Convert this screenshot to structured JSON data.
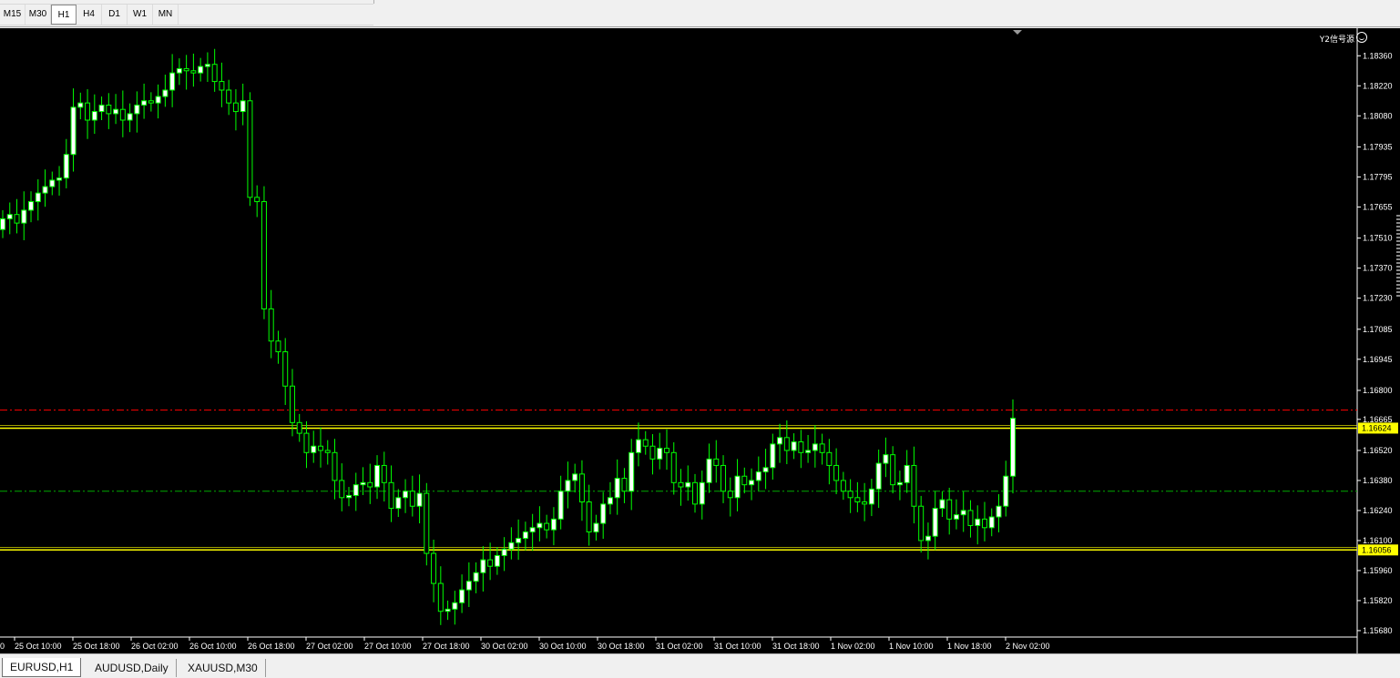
{
  "timeframes": [
    "M15",
    "M30",
    "H1",
    "H4",
    "D1",
    "W1",
    "MN"
  ],
  "active_timeframe": "H1",
  "corner_label": "Y2信号源",
  "tabs": [
    {
      "label": "EURUSD,H1",
      "active": true
    },
    {
      "label": "AUDUSD,Daily",
      "active": false
    },
    {
      "label": "XAUUSD,M30",
      "active": false
    }
  ],
  "colors": {
    "background": "#000000",
    "bull_fill": "#ffffff",
    "bull_outline": "#00ff00",
    "bear_fill": "#000000",
    "bear_outline": "#00ff00",
    "support_line": "#ffff00",
    "resistance_dash": "#ff0000",
    "mid_dash": "#00aa00",
    "axis_text": "#ffffff",
    "label_bg_yellow": "#ffff00"
  },
  "chart_data": {
    "type": "candlestick",
    "symbol": "EURUSD",
    "timeframe": "H1",
    "yticks": [
      "1.18360",
      "1.18220",
      "1.18080",
      "1.17935",
      "1.17795",
      "1.17655",
      "1.17510",
      "1.17370",
      "1.17230",
      "1.17085",
      "1.16945",
      "1.16800",
      "1.16665",
      "1.16520",
      "1.16380",
      "1.16240",
      "1.16100",
      "1.15960",
      "1.15820",
      "1.15680"
    ],
    "xticks": [
      "25 Oct 10:00",
      "25 Oct 18:00",
      "26 Oct 02:00",
      "26 Oct 10:00",
      "26 Oct 18:00",
      "27 Oct 02:00",
      "27 Oct 10:00",
      "27 Oct 18:00",
      "30 Oct 02:00",
      "30 Oct 10:00",
      "30 Oct 18:00",
      "31 Oct 02:00",
      "31 Oct 10:00",
      "31 Oct 18:00",
      "1 Nov 02:00",
      "1 Nov 10:00",
      "1 Nov 18:00",
      "2 Nov 02:00"
    ],
    "ylim": [
      1.1565,
      1.1848
    ],
    "horizontal_lines": [
      {
        "price": 1.16624,
        "style": "solid",
        "color": "support_line",
        "label": "1.16624"
      },
      {
        "price": 1.16056,
        "style": "solid",
        "color": "support_line",
        "label": "1.16056"
      },
      {
        "price": 1.16708,
        "style": "dashdot",
        "color": "resistance_dash"
      },
      {
        "price": 1.1633,
        "style": "dashdot",
        "color": "mid_dash"
      }
    ],
    "closes": [
      1.176,
      1.1762,
      1.1758,
      1.1764,
      1.1768,
      1.1772,
      1.1775,
      1.1778,
      1.1779,
      1.179,
      1.1812,
      1.1814,
      1.1806,
      1.181,
      1.1813,
      1.1809,
      1.1811,
      1.1806,
      1.1809,
      1.1813,
      1.1815,
      1.1814,
      1.1817,
      1.182,
      1.1828,
      1.183,
      1.1829,
      1.1828,
      1.1831,
      1.1832,
      1.1824,
      1.182,
      1.1814,
      1.181,
      1.1815,
      1.177,
      1.1768,
      1.1718,
      1.1703,
      1.1698,
      1.1682,
      1.1665,
      1.166,
      1.1651,
      1.1654,
      1.1652,
      1.1651,
      1.1638,
      1.163,
      1.1631,
      1.1636,
      1.1637,
      1.1635,
      1.1645,
      1.1637,
      1.1625,
      1.163,
      1.1633,
      1.1626,
      1.1632,
      1.1604,
      1.159,
      1.1577,
      1.1578,
      1.1581,
      1.1587,
      1.1591,
      1.1595,
      1.1601,
      1.1598,
      1.1603,
      1.1606,
      1.1609,
      1.1611,
      1.1614,
      1.1616,
      1.1618,
      1.1615,
      1.162,
      1.1633,
      1.1638,
      1.1641,
      1.1628,
      1.1614,
      1.1618,
      1.1627,
      1.163,
      1.1639,
      1.1633,
      1.1651,
      1.1657,
      1.1654,
      1.1648,
      1.1653,
      1.1651,
      1.1637,
      1.1635,
      1.1637,
      1.1627,
      1.1637,
      1.1648,
      1.1645,
      1.1633,
      1.163,
      1.164,
      1.1636,
      1.1638,
      1.1642,
      1.1644,
      1.1655,
      1.1658,
      1.1652,
      1.1656,
      1.1651,
      1.1652,
      1.1655,
      1.1651,
      1.1645,
      1.1638,
      1.1633,
      1.163,
      1.1628,
      1.1627,
      1.1634,
      1.1646,
      1.165,
      1.1636,
      1.1637,
      1.1645,
      1.1626,
      1.161,
      1.1612,
      1.1625,
      1.1629,
      1.162,
      1.1622,
      1.1624,
      1.1617,
      1.162,
      1.1616,
      1.1621,
      1.1626,
      1.164,
      1.1667
    ],
    "opens": [
      1.1755,
      1.176,
      1.1762,
      1.1758,
      1.1764,
      1.1768,
      1.1772,
      1.1775,
      1.1778,
      1.1779,
      1.179,
      1.1812,
      1.1814,
      1.1806,
      1.181,
      1.1813,
      1.1809,
      1.1811,
      1.1806,
      1.1809,
      1.1813,
      1.1815,
      1.1814,
      1.1817,
      1.182,
      1.1828,
      1.183,
      1.1829,
      1.1828,
      1.1831,
      1.1832,
      1.1824,
      1.182,
      1.1814,
      1.181,
      1.1815,
      1.177,
      1.1768,
      1.1718,
      1.1703,
      1.1698,
      1.1682,
      1.1665,
      1.166,
      1.1651,
      1.1654,
      1.1652,
      1.1651,
      1.1638,
      1.163,
      1.1631,
      1.1636,
      1.1637,
      1.1635,
      1.1645,
      1.1637,
      1.1625,
      1.163,
      1.1633,
      1.1626,
      1.1632,
      1.1604,
      1.159,
      1.1577,
      1.1578,
      1.1581,
      1.1587,
      1.1591,
      1.1595,
      1.1601,
      1.1598,
      1.1603,
      1.1606,
      1.1609,
      1.1611,
      1.1614,
      1.1616,
      1.1618,
      1.1615,
      1.162,
      1.1633,
      1.1638,
      1.1641,
      1.1628,
      1.1614,
      1.1618,
      1.1627,
      1.163,
      1.1639,
      1.1633,
      1.1651,
      1.1657,
      1.1654,
      1.1648,
      1.1653,
      1.1651,
      1.1637,
      1.1635,
      1.1637,
      1.1627,
      1.1637,
      1.1648,
      1.1645,
      1.1633,
      1.163,
      1.164,
      1.1636,
      1.1638,
      1.1642,
      1.1644,
      1.1655,
      1.1658,
      1.1652,
      1.1656,
      1.1651,
      1.1652,
      1.1655,
      1.1651,
      1.1645,
      1.1638,
      1.1633,
      1.163,
      1.1628,
      1.1627,
      1.1634,
      1.1646,
      1.165,
      1.1636,
      1.1637,
      1.1645,
      1.1626,
      1.161,
      1.1612,
      1.1625,
      1.1629,
      1.162,
      1.1622,
      1.1624,
      1.1617,
      1.162,
      1.1616,
      1.1621,
      1.1626,
      1.164
    ]
  }
}
